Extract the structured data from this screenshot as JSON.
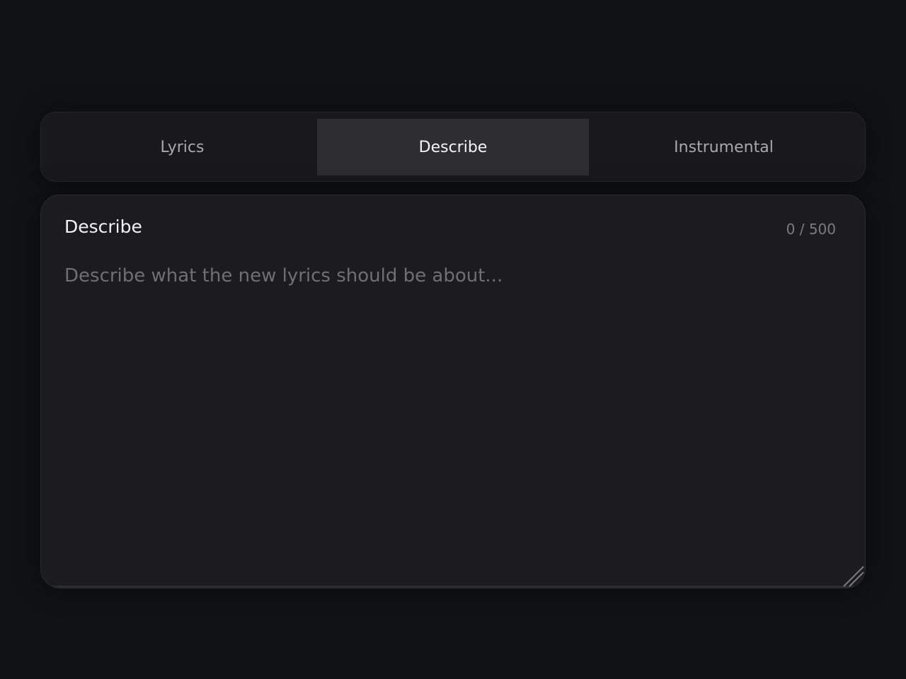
{
  "tabs": [
    {
      "label": "Lyrics",
      "active": false
    },
    {
      "label": "Describe",
      "active": true
    },
    {
      "label": "Instrumental",
      "active": false
    }
  ],
  "panel": {
    "title": "Describe",
    "counter": "0 / 500",
    "value": "",
    "placeholder": "Describe what the new lyrics should be about..."
  },
  "colors": {
    "background": "#111214",
    "active_tab": "#2e2e31",
    "panel": "#1c1c1e",
    "placeholder": "#6f6f74"
  }
}
